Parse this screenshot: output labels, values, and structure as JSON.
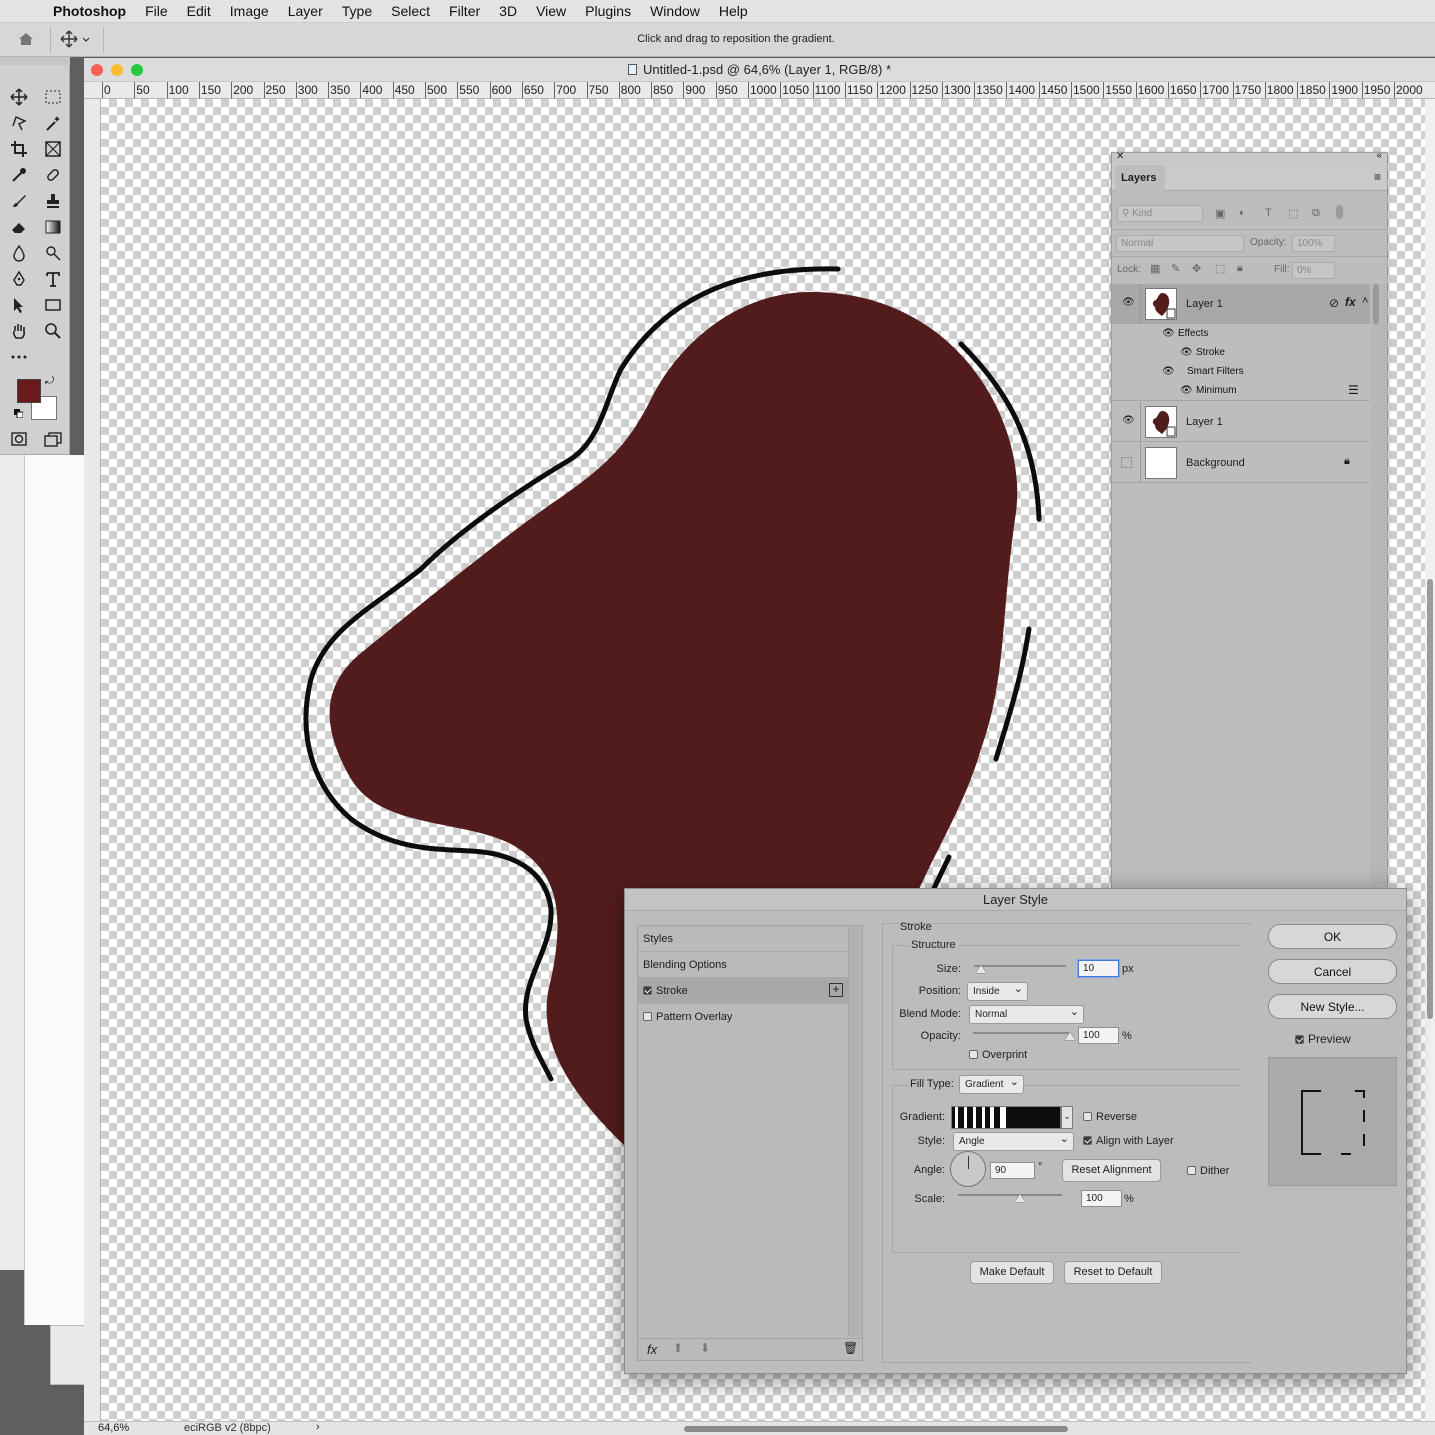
{
  "menubar": {
    "app": "Photoshop",
    "items": [
      "File",
      "Edit",
      "Image",
      "Layer",
      "Type",
      "Select",
      "Filter",
      "3D",
      "View",
      "Plugins",
      "Window",
      "Help"
    ]
  },
  "options_bar": {
    "hint": "Click and drag to reposition the gradient."
  },
  "document": {
    "title": "Untitled-1.psd @ 64,6% (Layer 1, RGB/8) *",
    "zoom": "64,6%",
    "color_profile": "eciRGB v2 (8bpc)",
    "ruler_h": [
      "0",
      "50",
      "100",
      "150",
      "200",
      "250",
      "300",
      "350",
      "400",
      "450",
      "500",
      "550",
      "600",
      "650",
      "700",
      "750",
      "800",
      "850",
      "900",
      "950",
      "1000",
      "1050",
      "1100",
      "1150",
      "1200",
      "1250",
      "1300",
      "1350",
      "1400",
      "1450",
      "1500",
      "1550",
      "1600",
      "1650",
      "1700",
      "1750",
      "1800",
      "1850",
      "1900",
      "1950",
      "2000"
    ],
    "shape_color": "#531c1c"
  },
  "colors": {
    "foreground": "#6a1a1a",
    "background": "#ffffff"
  },
  "layers_panel": {
    "tab": "Layers",
    "filter_kind": "Kind",
    "blend_mode": "Normal",
    "opacity_label": "Opacity:",
    "opacity_value": "100%",
    "lock_label": "Lock:",
    "fill_label": "Fill:",
    "fill_value": "0%",
    "layers": [
      {
        "name": "Layer 1",
        "effects_label": "Effects",
        "effect": "Stroke",
        "smart_filters": "Smart Filters",
        "filter": "Minimum"
      },
      {
        "name": "Layer 1"
      },
      {
        "name": "Background"
      }
    ]
  },
  "layer_style": {
    "title": "Layer Style",
    "styles": [
      "Styles",
      "Blending Options",
      "Stroke",
      "Pattern Overlay"
    ],
    "stroke_header": "Stroke",
    "structure_header": "Structure",
    "size_label": "Size:",
    "size_value": "10",
    "size_unit": "px",
    "size_slider": 0.08,
    "position_label": "Position:",
    "position_value": "Inside",
    "blend_label": "Blend Mode:",
    "blend_value": "Normal",
    "opacity_label": "Opacity:",
    "opacity_value": "100",
    "opacity_slider": 1.0,
    "percent": "%",
    "overprint_label": "Overprint",
    "fill_type_label": "Fill Type:",
    "fill_type_value": "Gradient",
    "gradient_label": "Gradient:",
    "reverse_label": "Reverse",
    "style_label": "Style:",
    "style_value": "Angle",
    "align_label": "Align with Layer",
    "angle_label": "Angle:",
    "angle_value": "90",
    "degree": "°",
    "reset_alignment": "Reset Alignment",
    "dither_label": "Dither",
    "scale_label": "Scale:",
    "scale_value": "100",
    "scale_slider": 0.6,
    "make_default": "Make Default",
    "reset_to_default": "Reset to Default",
    "ok": "OK",
    "cancel": "Cancel",
    "new_style": "New Style...",
    "preview_label": "Preview"
  }
}
